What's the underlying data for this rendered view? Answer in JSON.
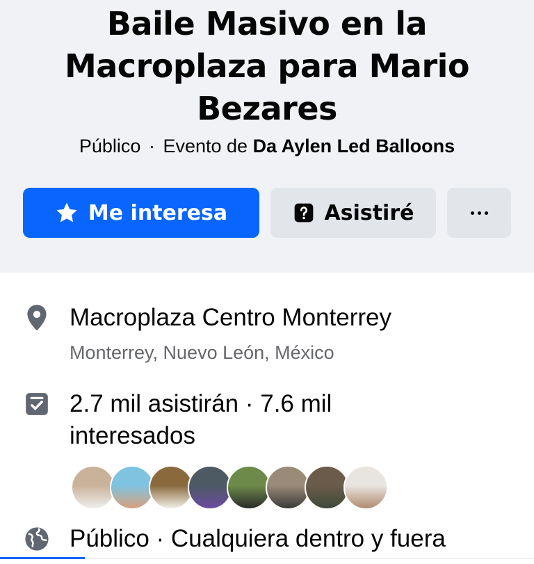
{
  "event": {
    "title": "Baile Masivo en la Macroplaza para Mario Bezares",
    "visibility": "Público",
    "separator": "·",
    "event_by_prefix": "Evento de",
    "organizer": "Da Aylen Led Balloons"
  },
  "actions": {
    "interested": {
      "label": "Me interesa",
      "icon": "star-icon"
    },
    "going": {
      "label": "Asistiré",
      "icon": "question-box-icon"
    },
    "more": {
      "icon": "more-dots-icon"
    }
  },
  "location": {
    "icon": "location-pin-icon",
    "name": "Macroplaza Centro Monterrey",
    "address": "Monterrey, Nuevo León, México"
  },
  "attendance": {
    "icon": "calendar-check-icon",
    "text": "2.7 mil asistirán · 7.6 mil interesados",
    "avatars": [
      {
        "colors": [
          "#c9b29a",
          "#efefef"
        ]
      },
      {
        "colors": [
          "#7fc3e0",
          "#d9a07c"
        ]
      },
      {
        "colors": [
          "#8a6a3d",
          "#f2efe6"
        ]
      },
      {
        "colors": [
          "#4d5a63",
          "#6b4aa0"
        ]
      },
      {
        "colors": [
          "#6e8a4a",
          "#2a2a2a"
        ]
      },
      {
        "colors": [
          "#9a8a78",
          "#3a3a3a"
        ]
      },
      {
        "colors": [
          "#6b5b4a",
          "#3d4a3a"
        ]
      },
      {
        "colors": [
          "#e8e4df",
          "#b08c6e"
        ]
      }
    ]
  },
  "privacy": {
    "icon": "globe-icon",
    "text": "Público · Cualquiera dentro y fuera"
  },
  "colors": {
    "primary": "#0866ff",
    "secondary_bg": "#e2e5e9",
    "header_bg": "#f0f2f5",
    "muted_text": "#65676b",
    "icon_gray": "#606770"
  }
}
